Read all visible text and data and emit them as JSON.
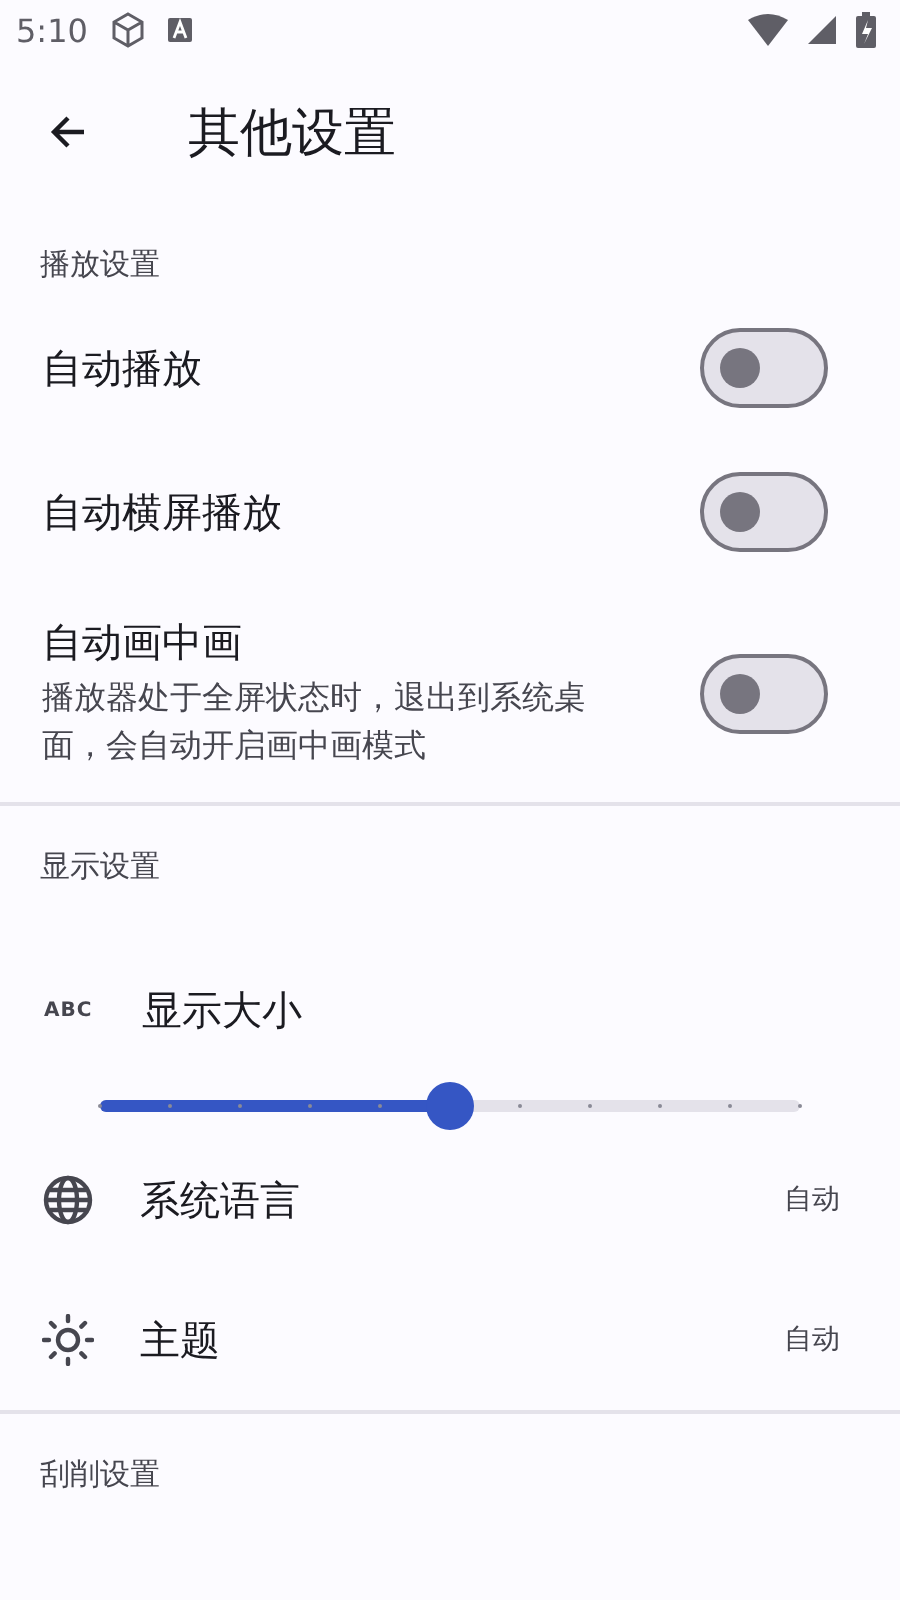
{
  "status_bar": {
    "time": "5:10"
  },
  "app_bar": {
    "title": "其他设置"
  },
  "sections": [
    {
      "header": "播放设置",
      "items": [
        {
          "kind": "switch",
          "title": "自动播放",
          "on": false
        },
        {
          "kind": "switch",
          "title": "自动横屏播放",
          "on": false
        },
        {
          "kind": "switch",
          "title": "自动画中画",
          "subtitle": "播放器处于全屏状态时，退出到系统桌面，会自动开启画中画模式",
          "on": false
        }
      ]
    },
    {
      "header": "显示设置",
      "items": [
        {
          "kind": "slider",
          "icon_text": "ABC",
          "title": "显示大小",
          "level": 0.5
        },
        {
          "kind": "value",
          "title": "系统语言",
          "value": "自动"
        },
        {
          "kind": "value",
          "title": "主题",
          "value": "自动"
        }
      ]
    },
    {
      "header": "刮削设置"
    }
  ]
}
